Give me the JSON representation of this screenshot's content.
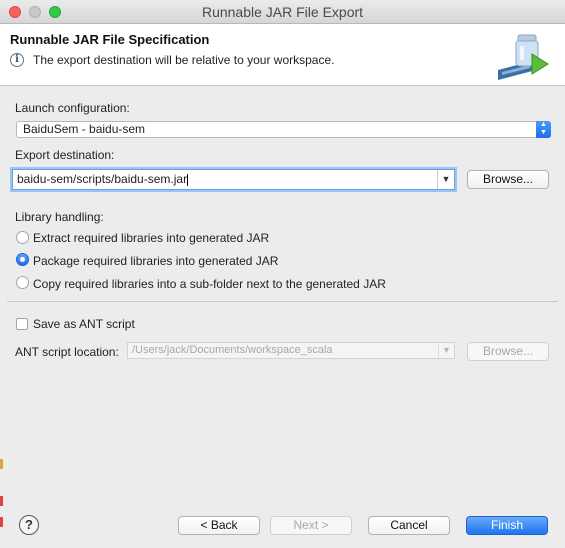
{
  "window": {
    "title": "Runnable JAR File Export"
  },
  "banner": {
    "title": "Runnable JAR File Specification",
    "message": "The export destination will be relative to your workspace.",
    "info_icon": "info-icon",
    "wizard_icon": "jar-export-icon"
  },
  "launch": {
    "label": "Launch configuration:",
    "value": "BaiduSem - baidu-sem"
  },
  "export": {
    "label": "Export destination:",
    "value": "baidu-sem/scripts/baidu-sem.jar",
    "browse": "Browse..."
  },
  "library": {
    "label": "Library handling:",
    "options": [
      {
        "label": "Extract required libraries into generated JAR",
        "checked": false
      },
      {
        "label": "Package required libraries into generated JAR",
        "checked": true
      },
      {
        "label": "Copy required libraries into a sub-folder next to the generated JAR",
        "checked": false
      }
    ]
  },
  "ant": {
    "checkbox_label": "Save as ANT script",
    "checked": false,
    "location_label": "ANT script location:",
    "location_value": "/Users/jack/Documents/workspace_scala",
    "browse": "Browse..."
  },
  "buttons": {
    "help": "?",
    "back": "< Back",
    "next": "Next >",
    "cancel": "Cancel",
    "finish": "Finish"
  },
  "colors": {
    "accent": "#1e75f0",
    "window_bg": "#ececec",
    "banner_bg": "#ffffff"
  }
}
